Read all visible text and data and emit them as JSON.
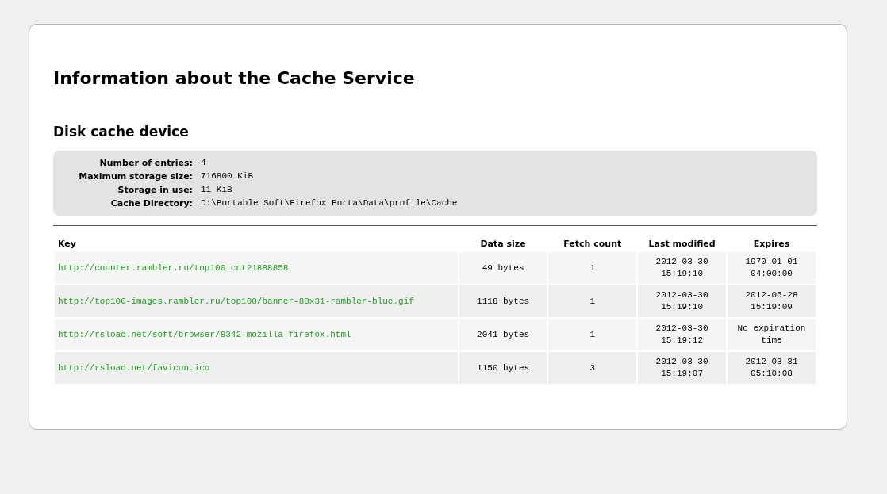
{
  "title": "Information about the Cache Service",
  "device": {
    "heading": "Disk cache device",
    "fields": [
      {
        "label": "Number of entries:",
        "value": "4"
      },
      {
        "label": "Maximum storage size:",
        "value": "716800 KiB"
      },
      {
        "label": "Storage in use:",
        "value": "11 KiB"
      },
      {
        "label": "Cache Directory:",
        "value": "D:\\Portable Soft\\Firefox Porta\\Data\\profile\\Cache"
      }
    ]
  },
  "table": {
    "columns": [
      "Key",
      "Data size",
      "Fetch count",
      "Last modified",
      "Expires"
    ],
    "rows": [
      {
        "key": "http://counter.rambler.ru/top100.cnt?1888858",
        "data_size": "49 bytes",
        "fetch_count": "1",
        "last_modified": "2012-03-30 15:19:10",
        "expires": "1970-01-01 04:00:00"
      },
      {
        "key": "http://top100-images.rambler.ru/top100/banner-88x31-rambler-blue.gif",
        "data_size": "1118 bytes",
        "fetch_count": "1",
        "last_modified": "2012-03-30 15:19:10",
        "expires": "2012-06-28 15:19:09"
      },
      {
        "key": "http://rsload.net/soft/browser/8342-mozilla-firefox.html",
        "data_size": "2041 bytes",
        "fetch_count": "1",
        "last_modified": "2012-03-30 15:19:12",
        "expires": "No expiration time"
      },
      {
        "key": "http://rsload.net/favicon.ico",
        "data_size": "1150 bytes",
        "fetch_count": "3",
        "last_modified": "2012-03-30 15:19:07",
        "expires": "2012-03-31 05:10:08"
      }
    ]
  }
}
